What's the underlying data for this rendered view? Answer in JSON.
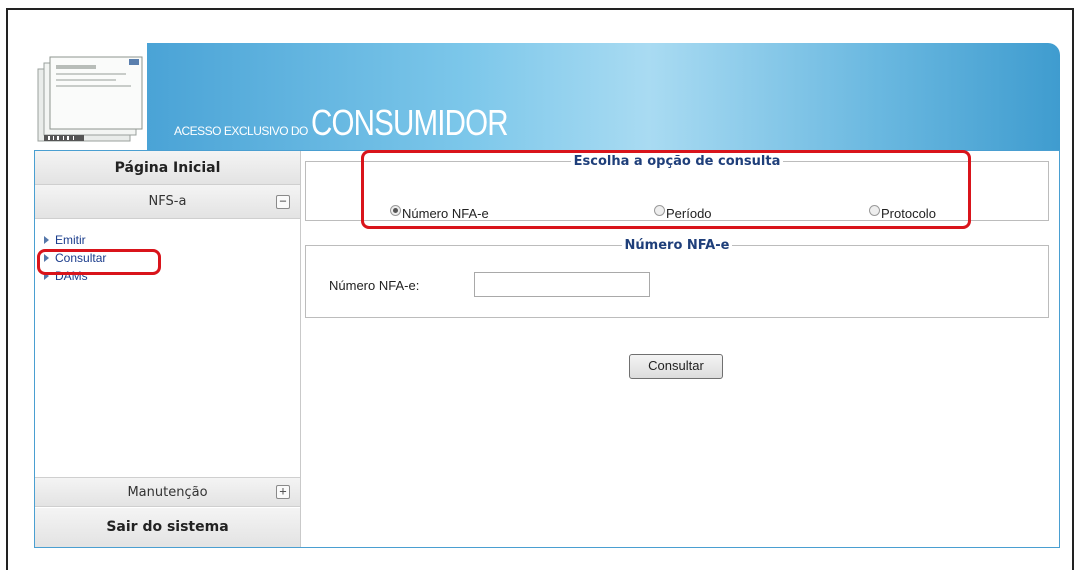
{
  "banner": {
    "slogan_small": "ACESSO EXCLUSIVO DO",
    "slogan_big": "CONSUMIDOR"
  },
  "sidebar": {
    "home_label": "Página Inicial",
    "section_nfsa": {
      "label": "NFS-a",
      "toggle": "−"
    },
    "items": [
      {
        "label": "Emitir"
      },
      {
        "label": "Consultar"
      },
      {
        "label": "DAMs"
      }
    ],
    "section_manutencao": {
      "label": "Manutenção",
      "toggle": "+"
    },
    "logout_label": "Sair do sistema"
  },
  "consulta_options": {
    "legend": "Escolha a opção de consulta",
    "options": [
      {
        "label": "Número NFA-e",
        "checked": true
      },
      {
        "label": "Período",
        "checked": false
      },
      {
        "label": "Protocolo",
        "checked": false
      }
    ]
  },
  "numero_section": {
    "legend": "Número NFA-e",
    "field_label": "Número NFA-e:",
    "field_value": ""
  },
  "submit_label": "Consultar",
  "colors": {
    "highlight": "#d9141b",
    "banner_blue": "#4aa3d6",
    "link_blue": "#1a3c8c",
    "legend_blue": "#1f3f7a"
  }
}
